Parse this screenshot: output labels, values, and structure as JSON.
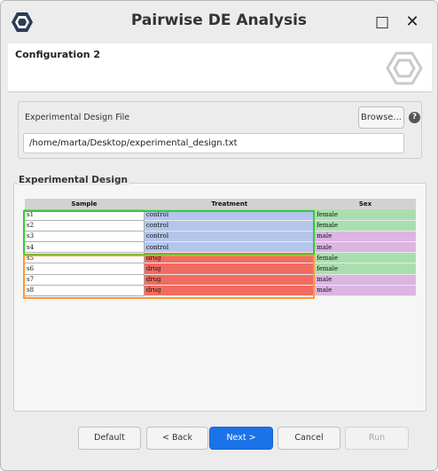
{
  "window": {
    "title": "Pairwise DE Analysis",
    "maximize_glyph": "□",
    "close_glyph": "✕"
  },
  "header": {
    "title": "Configuration 2"
  },
  "file_section": {
    "label": "Experimental Design File",
    "browse_label": "Browse...",
    "help_glyph": "?",
    "path_value": "/home/marta/Desktop/experimental_design.txt"
  },
  "design": {
    "title": "Experimental Design",
    "columns": [
      "Sample",
      "Treatment",
      "Sex"
    ],
    "rows": [
      {
        "sample": "s1",
        "treatment": "control",
        "sex": "female"
      },
      {
        "sample": "s2",
        "treatment": "control",
        "sex": "female"
      },
      {
        "sample": "s3",
        "treatment": "control",
        "sex": "male"
      },
      {
        "sample": "s4",
        "treatment": "control",
        "sex": "male"
      },
      {
        "sample": "s5",
        "treatment": "drug",
        "sex": "female"
      },
      {
        "sample": "s6",
        "treatment": "drug",
        "sex": "female"
      },
      {
        "sample": "s7",
        "treatment": "drug",
        "sex": "male"
      },
      {
        "sample": "s8",
        "treatment": "drug",
        "sex": "male"
      }
    ],
    "colors": {
      "control": "#b4c6ec",
      "drug": "#f26b61",
      "female": "#a9dfae",
      "male": "#dcb5e3",
      "group_control_border": "#33cc33",
      "group_drug_border": "#ff9933"
    }
  },
  "buttons": {
    "default": "Default",
    "back": "< Back",
    "next": "Next >",
    "cancel": "Cancel",
    "run": "Run"
  },
  "colors": {
    "accent": "#1a73e8"
  }
}
